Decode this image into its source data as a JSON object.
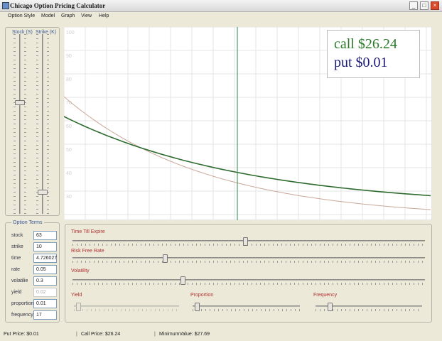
{
  "window": {
    "title": "Chicago Option Pricing Calculator",
    "minimize": "_",
    "maximize": "□",
    "close": "×"
  },
  "menu": [
    "Option Style",
    "Model",
    "Graph",
    "View",
    "Help"
  ],
  "sliders_panel": {
    "stock_label": "Stock (S)",
    "strike_label": "Strike (K)",
    "stock_level": 0.38,
    "strike_level": 0.89
  },
  "chart": {
    "call_text": "call $26.24",
    "put_text": "put $0.01",
    "colors": {
      "call": "#2a7a2a",
      "put": "#1a1a7a",
      "curve": "#2e6b2e",
      "curve2": "#c8a898",
      "vline": "#2a8a4a"
    },
    "ytick_labels": [
      "100",
      "90",
      "80",
      "70",
      "60",
      "50",
      "40",
      "30"
    ]
  },
  "option_terms": {
    "title": "Option Terms",
    "fields": [
      {
        "label": "stock",
        "value": "63",
        "disabled": false
      },
      {
        "label": "strike",
        "value": "10",
        "disabled": false
      },
      {
        "label": "time",
        "value": "4.726027",
        "disabled": false
      },
      {
        "label": "rate",
        "value": "0.05",
        "disabled": false
      },
      {
        "label": "volatilie",
        "value": "0.3",
        "disabled": false
      },
      {
        "label": "yield",
        "value": "0.02",
        "disabled": true
      },
      {
        "label": "proportion",
        "value": "0.01",
        "disabled": false
      },
      {
        "label": "frequency",
        "value": "17",
        "disabled": false
      }
    ]
  },
  "param_sliders": {
    "time": {
      "label": "Time Till Expire",
      "level": 0.49
    },
    "rate": {
      "label": "Risk Free Rate",
      "level": 0.26
    },
    "volatility": {
      "label": "Volatility",
      "level": 0.31
    },
    "yield": {
      "label": "Yield",
      "level": 0.02
    },
    "proportion": {
      "label": "Proportion",
      "level": 0.02
    },
    "frequency": {
      "label": "Frequency",
      "level": 0.12
    }
  },
  "status": {
    "put": "Put Price:   $0.01",
    "call": "Call Price:   $26.24",
    "minimum": "MinimumValue:   $27.69"
  }
}
